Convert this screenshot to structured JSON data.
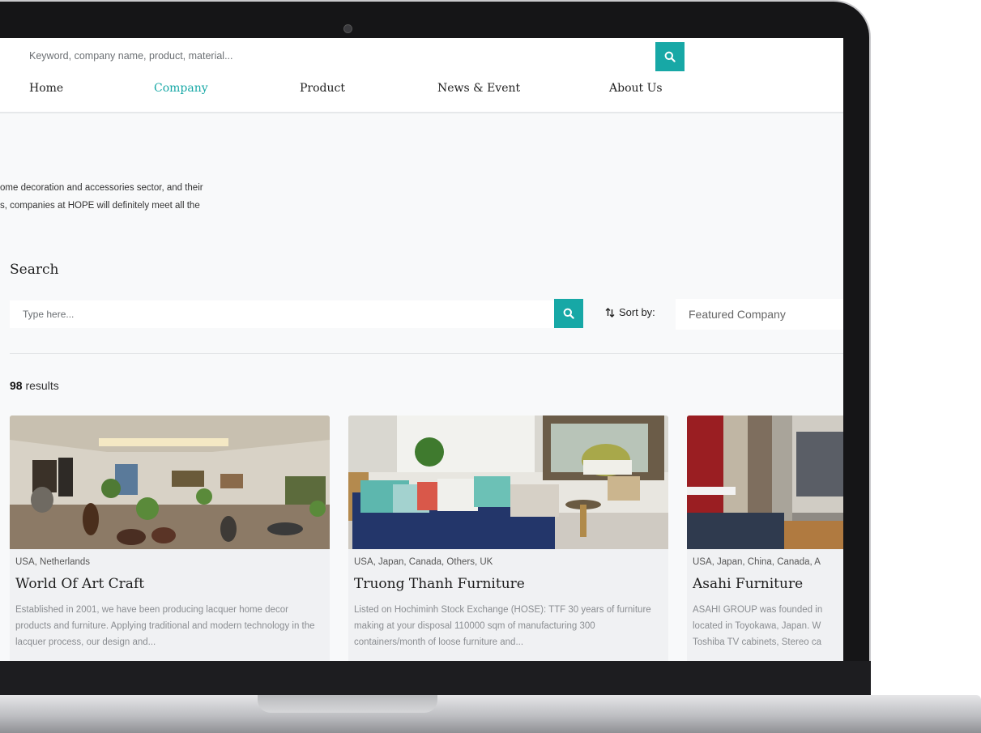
{
  "header": {
    "search_placeholder": "Keyword, company name, product, material...",
    "nav": [
      "Home",
      "Company",
      "Product",
      "News & Event",
      "About Us"
    ],
    "active_nav": "Company"
  },
  "intro": {
    "line1": "ome decoration and accessories sector, and their",
    "line2": "s, companies at HOPE will definitely meet all the"
  },
  "search": {
    "title": "Search",
    "placeholder": "Type here...",
    "sort_label": "Sort by:",
    "sort_value": "Featured Company"
  },
  "results": {
    "count": "98",
    "label": "results"
  },
  "cards": [
    {
      "countries": "USA, Netherlands",
      "name": "World Of Art Craft",
      "description": "Established in 2001, we have been producing lacquer home decor products and furniture. Applying traditional and modern technology in the lacquer process, our design and..."
    },
    {
      "countries": "USA, Japan, Canada, Others, UK",
      "name": "Truong Thanh Furniture",
      "description": "Listed on Hochiminh Stock Exchange (HOSE): TTF 30 years of furniture making at your disposal 110000 sqm of manufacturing 300 containers/month of loose furniture and..."
    },
    {
      "countries": "USA, Japan, China, Canada, A",
      "name": "Asahi Furniture",
      "description": "ASAHI GROUP was founded in located in Toyokawa, Japan. W Toshiba TV cabinets, Stereo ca"
    }
  ],
  "colors": {
    "accent": "#17a8a6",
    "page_bg": "#f8f9fa",
    "card_bg": "#f0f1f3"
  },
  "icons": {
    "search": "magnifier-icon",
    "sort": "sort-arrows-icon"
  }
}
